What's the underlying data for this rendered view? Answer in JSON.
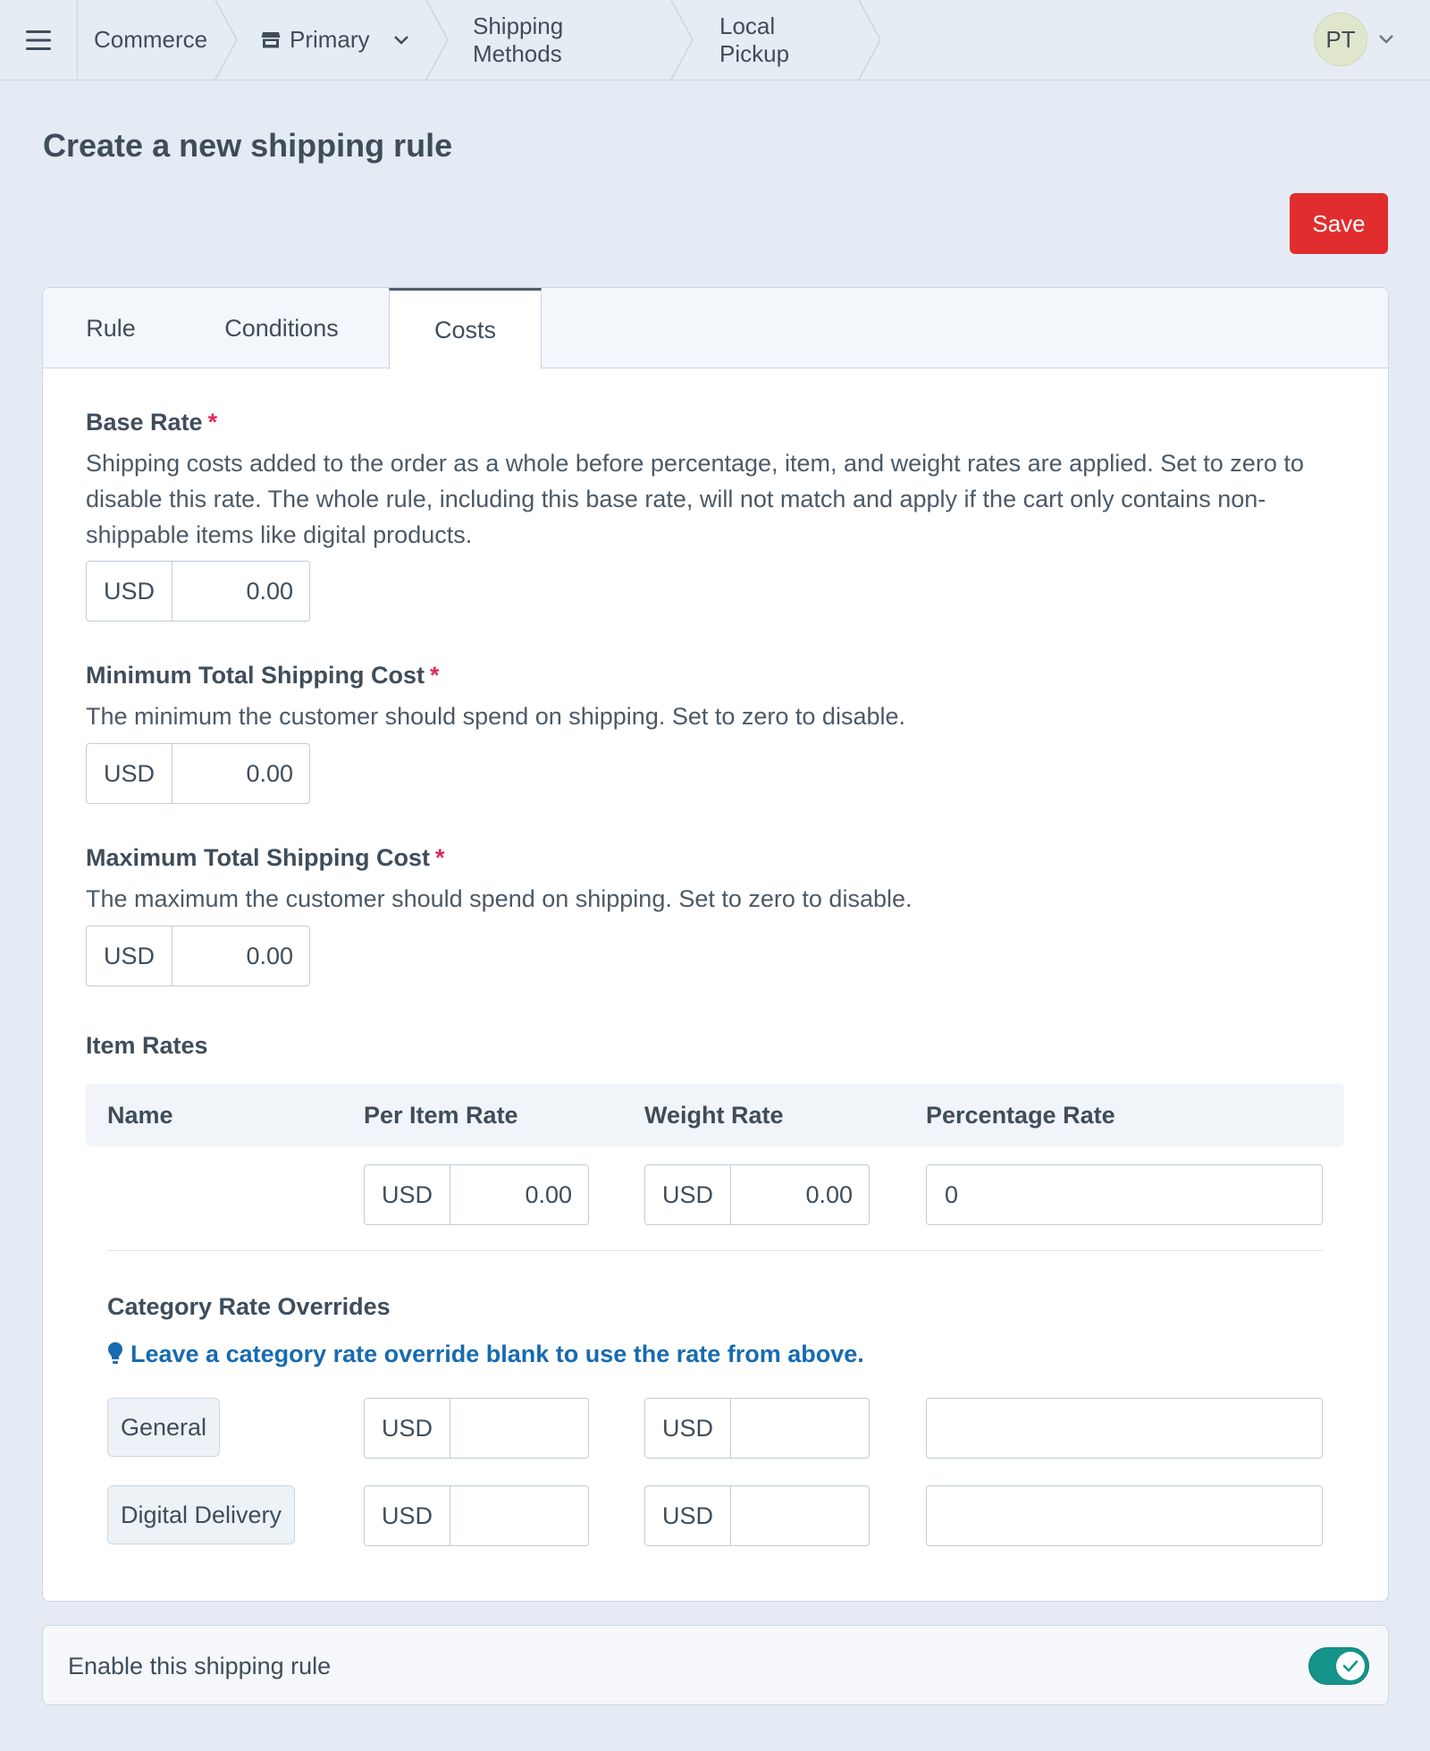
{
  "header": {
    "breadcrumbs": [
      {
        "label": "Commerce"
      },
      {
        "label": "Primary"
      },
      {
        "label": "Shipping Methods"
      },
      {
        "label": "Local Pickup"
      }
    ],
    "user_initials": "PT"
  },
  "page": {
    "title": "Create a new shipping rule",
    "save_label": "Save"
  },
  "tabs": [
    {
      "label": "Rule"
    },
    {
      "label": "Conditions"
    },
    {
      "label": "Costs",
      "active": true
    }
  ],
  "fields": {
    "base_rate": {
      "label": "Base Rate",
      "required_mark": "*",
      "help": "Shipping costs added to the order as a whole before percentage, item, and weight rates are applied. Set to zero to disable this rate. The whole rule, including this base rate, will not match and apply if the cart only contains non-shippable items like digital products.",
      "currency": "USD",
      "value": "0.00"
    },
    "min_total": {
      "label": "Minimum Total Shipping Cost",
      "required_mark": "*",
      "help": "The minimum the customer should spend on shipping. Set to zero to disable.",
      "currency": "USD",
      "value": "0.00"
    },
    "max_total": {
      "label": "Maximum Total Shipping Cost",
      "required_mark": "*",
      "help": "The maximum the customer should spend on shipping. Set to zero to disable.",
      "currency": "USD",
      "value": "0.00"
    }
  },
  "item_rates": {
    "title": "Item Rates",
    "columns": [
      "Name",
      "Per Item Rate",
      "Weight Rate",
      "Percentage Rate"
    ],
    "default_row": {
      "per_item_currency": "USD",
      "per_item_value": "0.00",
      "weight_currency": "USD",
      "weight_value": "0.00",
      "percentage_value": "0"
    },
    "overrides_title": "Category Rate Overrides",
    "overrides_tip": "Leave a category rate override blank to use the rate from above.",
    "categories": [
      {
        "name": "General",
        "per_item_currency": "USD",
        "weight_currency": "USD"
      },
      {
        "name": "Digital Delivery",
        "per_item_currency": "USD",
        "weight_currency": "USD"
      }
    ]
  },
  "enable": {
    "label": "Enable this shipping rule",
    "on": true
  },
  "colors": {
    "accent_red": "#e12d2d",
    "toggle_on": "#14948a",
    "tip_blue": "#176bb0",
    "required": "#e0285a"
  }
}
